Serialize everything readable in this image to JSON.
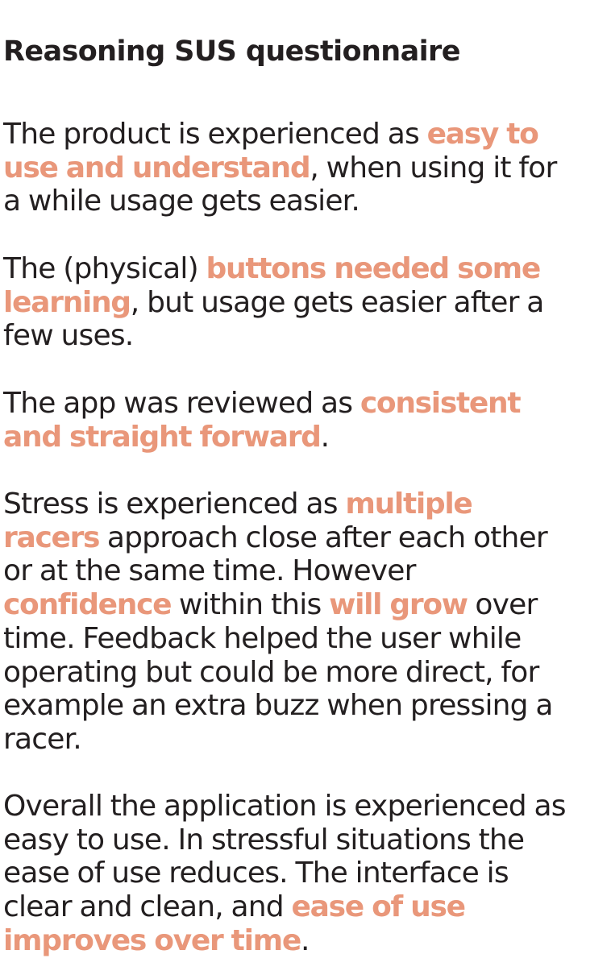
{
  "title": "Reasoning SUS questionnaire",
  "colors": {
    "text": "#231f20",
    "highlight": "#e9977a",
    "background": "#ffffff"
  },
  "paragraphs": [
    {
      "segments": [
        {
          "text": "The product is experienced as ",
          "highlight": false
        },
        {
          "text": "easy to use and understand",
          "highlight": true
        },
        {
          "text": ", when using it for a while usage gets easier.",
          "highlight": false
        }
      ]
    },
    {
      "segments": [
        {
          "text": "The (physical) ",
          "highlight": false
        },
        {
          "text": "buttons needed some learning",
          "highlight": true
        },
        {
          "text": ", but usage gets easier after a few uses.",
          "highlight": false
        }
      ]
    },
    {
      "segments": [
        {
          "text": "The app was reviewed as ",
          "highlight": false
        },
        {
          "text": "consistent and straight forward",
          "highlight": true
        },
        {
          "text": ".",
          "highlight": false
        }
      ]
    },
    {
      "segments": [
        {
          "text": "Stress is experienced as ",
          "highlight": false
        },
        {
          "text": "multiple racers",
          "highlight": true
        },
        {
          "text": " approach close after each other or at the same time. However ",
          "highlight": false
        },
        {
          "text": "confidence",
          "highlight": true
        },
        {
          "text": " within this ",
          "highlight": false
        },
        {
          "text": "will grow",
          "highlight": true
        },
        {
          "text": " over time. Feedback helped the user while operating but could be more direct, for example an extra buzz when pressing a racer.",
          "highlight": false
        }
      ]
    },
    {
      "segments": [
        {
          "text": "Overall the application is experienced as easy to use. In stressful situations the ease of use reduces. The interface is clear and clean, and ",
          "highlight": false
        },
        {
          "text": "ease of use improves over time",
          "highlight": true
        },
        {
          "text": ".",
          "highlight": false
        }
      ]
    }
  ]
}
